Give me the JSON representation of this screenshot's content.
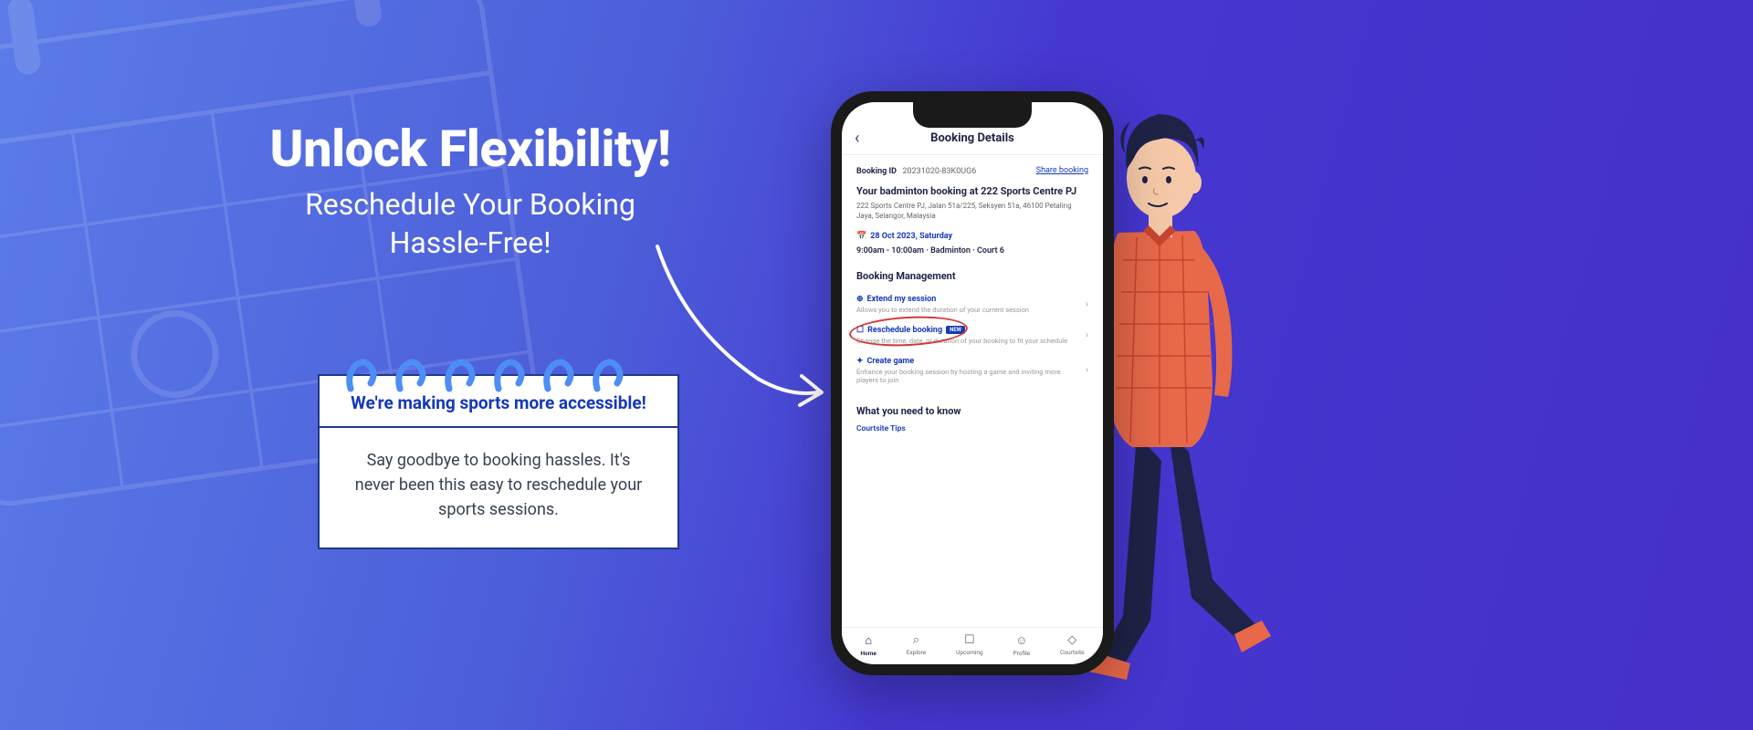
{
  "hero": {
    "headline": "Unlock Flexibility!",
    "subtitle_line1": "Reschedule Your Booking",
    "subtitle_line2": "Hassle-Free!"
  },
  "notepad": {
    "header": "We're making sports more accessible!",
    "body": "Say goodbye to booking hassles. It's never been this easy to reschedule your sports sessions."
  },
  "phone": {
    "header_title": "Booking Details",
    "booking_id_label": "Booking ID",
    "booking_id": "20231020-83K0UG6",
    "share_label": "Share booking",
    "booking_title": "Your badminton booking at 222 Sports Centre PJ",
    "address": "222 Sports Centre PJ, Jalan 51a/225, Seksyen 51a, 46100 Petaling Jaya, Selangor, Malaysia",
    "date": "28 Oct 2023, Saturday",
    "time_slot": "9:00am - 10:00am · Badminton · Court 6",
    "management_title": "Booking Management",
    "management": [
      {
        "title": "Extend my session",
        "desc": "Allows you to extend the duration of your current session",
        "badge": ""
      },
      {
        "title": "Reschedule booking",
        "desc": "Change the time, date, or duration of your booking to fit your schedule",
        "badge": "NEW"
      },
      {
        "title": "Create game",
        "desc": "Enhance your booking session by hosting a game and inviting more players to join",
        "badge": ""
      }
    ],
    "know_title": "What you need to know",
    "tips_label": "Courtsite Tips",
    "nav": [
      {
        "label": "Home"
      },
      {
        "label": "Explore"
      },
      {
        "label": "Upcoming"
      },
      {
        "label": "Profile"
      },
      {
        "label": "Courtsite"
      }
    ]
  }
}
